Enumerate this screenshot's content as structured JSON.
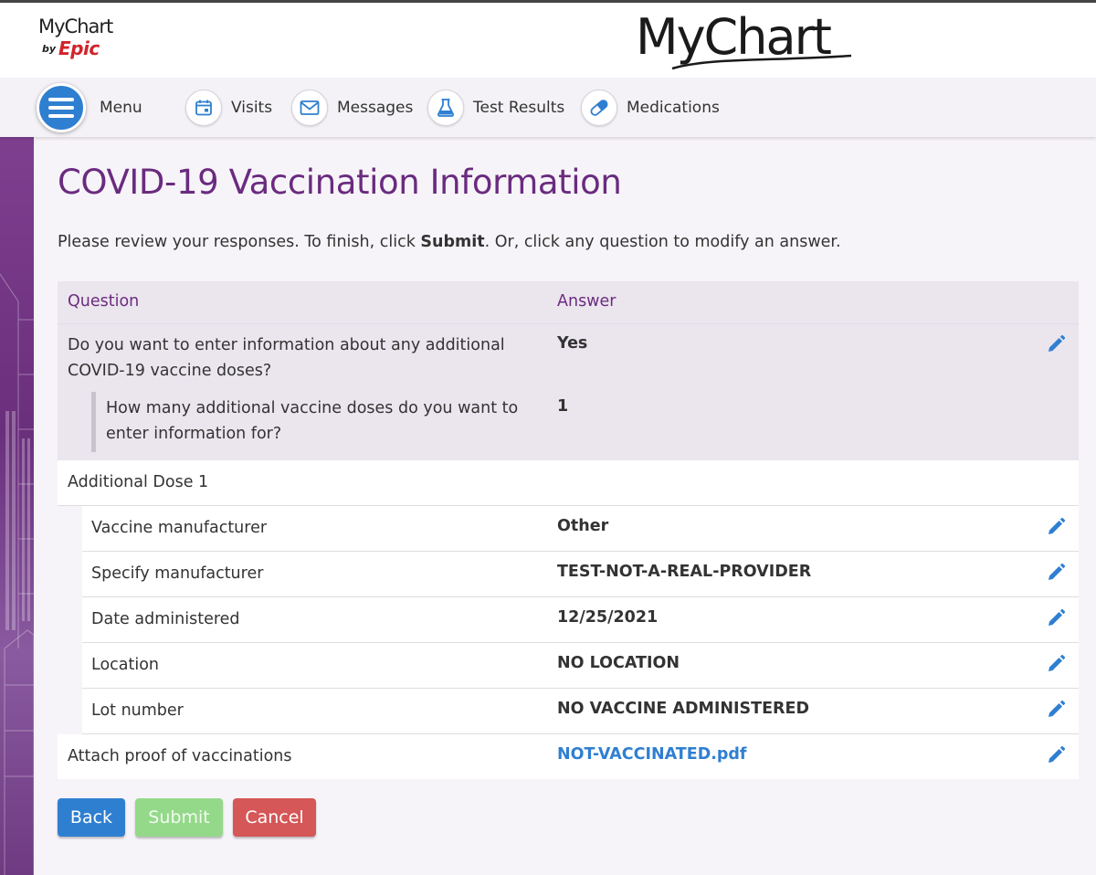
{
  "header": {
    "small_logo": {
      "name": "MyChart",
      "by": "by",
      "brand": "Epic"
    },
    "big_logo": "MyChart"
  },
  "nav": {
    "menu_label": "Menu",
    "items": [
      {
        "label": "Visits",
        "icon": "calendar-icon"
      },
      {
        "label": "Messages",
        "icon": "envelope-icon"
      },
      {
        "label": "Test Results",
        "icon": "flask-icon"
      },
      {
        "label": "Medications",
        "icon": "pill-icon"
      }
    ]
  },
  "page": {
    "title": "COVID-19 Vaccination Information",
    "intro_before": "Please review your responses. To finish, click ",
    "intro_bold": "Submit",
    "intro_after": ". Or, click any question to modify an answer."
  },
  "table": {
    "question_header": "Question",
    "answer_header": "Answer",
    "q1": {
      "question": "Do you want to enter information about any additional COVID-19 vaccine doses?",
      "answer": "Yes"
    },
    "q1_sub": {
      "question": "How many additional vaccine doses do you want to enter information for?",
      "answer": "1"
    },
    "dose_heading": "Additional Dose 1",
    "dose_rows": [
      {
        "question": "Vaccine manufacturer",
        "answer": "Other"
      },
      {
        "question": "Specify manufacturer",
        "answer": "TEST-NOT-A-REAL-PROVIDER"
      },
      {
        "question": "Date administered",
        "answer": "12/25/2021"
      },
      {
        "question": "Location",
        "answer": "NO LOCATION"
      },
      {
        "question": "Lot number",
        "answer": "NO VACCINE ADMINISTERED"
      }
    ],
    "attach": {
      "question": "Attach proof of vaccinations",
      "answer": "NOT-VACCINATED.pdf"
    }
  },
  "buttons": {
    "back": "Back",
    "submit": "Submit",
    "cancel": "Cancel"
  },
  "colors": {
    "accent_purple": "#6a2b7f",
    "link_blue": "#2f7fd1",
    "back_button": "#2f7fd1",
    "submit_button_disabled": "#94d98a",
    "cancel_button": "#d55757",
    "epic_red": "#d2232a"
  }
}
